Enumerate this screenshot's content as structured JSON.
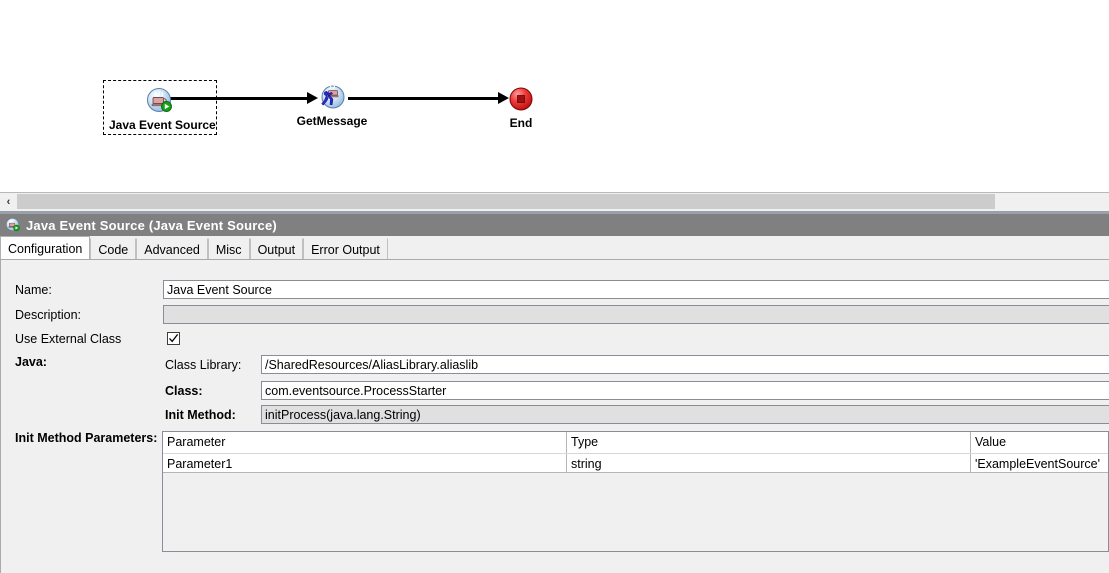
{
  "diagram": {
    "nodes": [
      {
        "id": "java-event-source",
        "label": "Java Event Source",
        "icon": "java-event-source-icon",
        "selected": true
      },
      {
        "id": "get-message",
        "label": "GetMessage",
        "icon": "activity-icon",
        "selected": false
      },
      {
        "id": "end",
        "label": "End",
        "icon": "end-icon",
        "selected": false
      }
    ],
    "connectors": [
      {
        "from": "java-event-source",
        "to": "get-message"
      },
      {
        "from": "get-message",
        "to": "end"
      }
    ]
  },
  "scrollbar": {
    "left_arrow": "‹"
  },
  "titlebar": {
    "icon": "java-event-source-icon",
    "text": "Java Event Source (Java Event Source)"
  },
  "tabs": [
    {
      "label": "Configuration",
      "active": true
    },
    {
      "label": "Code",
      "active": false
    },
    {
      "label": "Advanced",
      "active": false
    },
    {
      "label": "Misc",
      "active": false
    },
    {
      "label": "Output",
      "active": false
    },
    {
      "label": "Error Output",
      "active": false
    }
  ],
  "form": {
    "name_label": "Name:",
    "name_value": "Java Event Source",
    "description_label": "Description:",
    "description_value": "",
    "use_external_class_label": "Use External Class",
    "use_external_class_checked": true,
    "java_label": "Java:",
    "class_library_label": "Class Library:",
    "class_library_value": "/SharedResources/AliasLibrary.aliaslib",
    "class_label": "Class:",
    "class_value": "com.eventsource.ProcessStarter",
    "init_method_label": "Init Method:",
    "init_method_value": "initProcess(java.lang.String)",
    "init_method_parameters_label": "Init Method Parameters:"
  },
  "param_table": {
    "columns": [
      "Parameter",
      "Type",
      "Value"
    ],
    "rows": [
      {
        "parameter": "Parameter1",
        "type": "string",
        "value": "'ExampleEventSource'"
      }
    ]
  },
  "colors": {
    "titlebar_bg": "#808080",
    "panel_bg": "#f0f0f0",
    "field_bg": "#ffffff",
    "field_disabled_bg": "#e0e0e0",
    "canvas_bg": "#ffffff",
    "end_node": "#e02020",
    "badge_green": "#18a018"
  }
}
